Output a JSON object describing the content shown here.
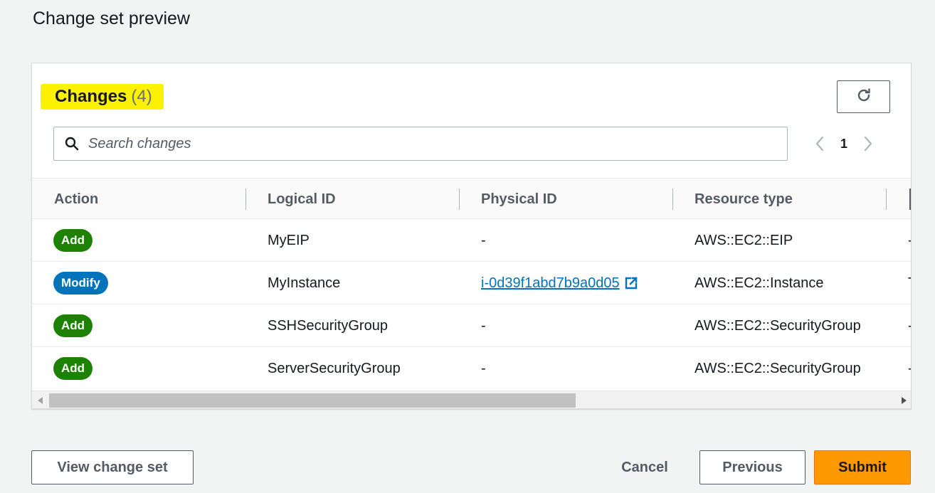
{
  "page": {
    "title": "Change set preview"
  },
  "panel": {
    "title": "Changes",
    "count": "(4)",
    "search": {
      "placeholder": "Search changes",
      "value": ""
    },
    "pagination": {
      "current_page": "1"
    }
  },
  "table": {
    "columns": [
      "Action",
      "Logical ID",
      "Physical ID",
      "Resource type"
    ],
    "rows": [
      {
        "action": "Add",
        "logical_id": "MyEIP",
        "physical_id": "-",
        "physical_is_link": false,
        "resource_type": "AWS::EC2::EIP",
        "trailing": "-"
      },
      {
        "action": "Modify",
        "logical_id": "MyInstance",
        "physical_id": "i-0d39f1abd7b9a0d05",
        "physical_is_link": true,
        "resource_type": "AWS::EC2::Instance",
        "trailing": "T"
      },
      {
        "action": "Add",
        "logical_id": "SSHSecurityGroup",
        "physical_id": "-",
        "physical_is_link": false,
        "resource_type": "AWS::EC2::SecurityGroup",
        "trailing": "-"
      },
      {
        "action": "Add",
        "logical_id": "ServerSecurityGroup",
        "physical_id": "-",
        "physical_is_link": false,
        "resource_type": "AWS::EC2::SecurityGroup",
        "trailing": "-"
      }
    ],
    "horizontal_scroll_fraction": 0.6
  },
  "footer": {
    "view_change_set": "View change set",
    "cancel": "Cancel",
    "previous": "Previous",
    "submit": "Submit"
  },
  "colors": {
    "add_badge": "#1d8102",
    "modify_badge": "#0073bb",
    "highlight": "#fff200",
    "primary_button": "#ff9900",
    "link": "#0073bb"
  },
  "icons": [
    "refresh-icon",
    "search-icon",
    "chevron-left-icon",
    "chevron-right-icon",
    "external-link-icon",
    "scroll-left-arrow-icon",
    "scroll-right-arrow-icon"
  ]
}
